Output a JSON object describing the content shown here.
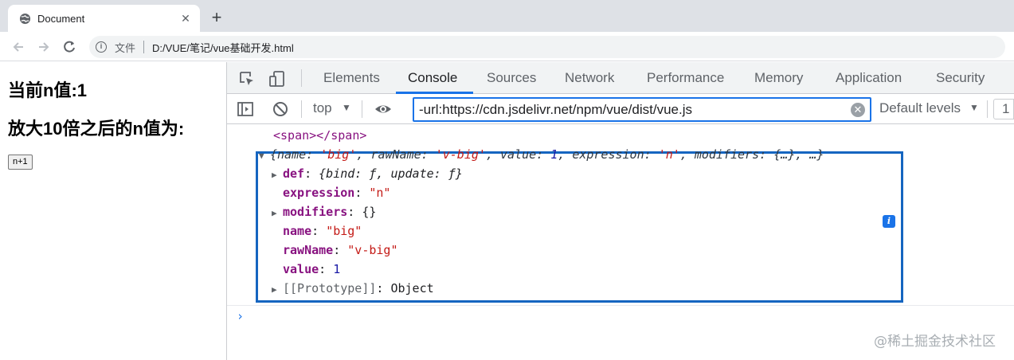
{
  "browser": {
    "tab_title": "Document",
    "tab_close": "✕",
    "new_tab": "+",
    "omnibox_label": "文件",
    "url": "D:/VUE/笔记/vue基础开发.html"
  },
  "page": {
    "heading1": "当前n值:1",
    "heading2": "放大10倍之后的n值为:",
    "button_label": "n+1"
  },
  "devtools": {
    "tabs": [
      "Elements",
      "Console",
      "Sources",
      "Network",
      "Performance",
      "Memory",
      "Application",
      "Security"
    ],
    "active_tab": "Console",
    "context": "top",
    "filter_value": "-url:https://cdn.jsdelivr.net/npm/vue/dist/vue.js",
    "levels": "Default levels",
    "count": "1",
    "accent_color": "#1a73e8"
  },
  "console": {
    "element_line": "<span></span>",
    "object_summary": {
      "open": "{",
      "name_key": "name",
      "name_val": "'big'",
      "rawName_key": "rawName",
      "rawName_val": "'v-big'",
      "value_key": "value",
      "value_val": "1",
      "expression_key": "expression",
      "expression_val": "'n'",
      "modifiers_key": "modifiers",
      "modifiers_val": "{…}",
      "ellipsis": "…}"
    },
    "props": {
      "def_key": "def",
      "def_val": "{bind: ƒ, update: ƒ}",
      "expression_key": "expression",
      "expression_val": "\"n\"",
      "modifiers_key": "modifiers",
      "modifiers_val": "{}",
      "name_key": "name",
      "name_val": "\"big\"",
      "rawName_key": "rawName",
      "rawName_val": "\"v-big\"",
      "value_key": "value",
      "value_val": "1",
      "proto_key": "[[Prototype]]",
      "proto_val": "Object"
    },
    "info_badge": "i",
    "prompt": "›"
  },
  "watermark": "@稀土掘金技术社区"
}
